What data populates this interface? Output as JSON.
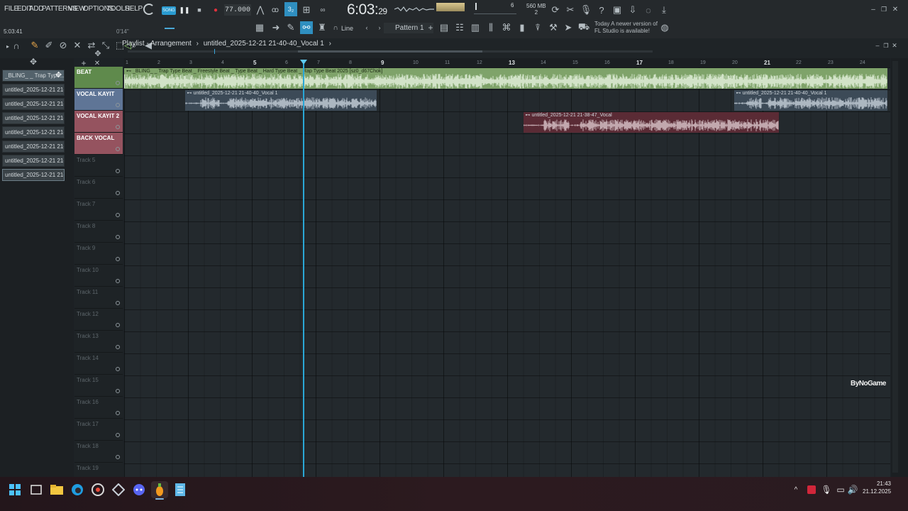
{
  "menu": {
    "items": [
      "FILE",
      "EDIT",
      "ADD",
      "PATTERNS",
      "VIEW",
      "OPTIONS",
      "TOOLS",
      "HELP"
    ]
  },
  "transport": {
    "mode": "SONG",
    "tempo": "77.000",
    "time_main": "6:03",
    "time_sub": "29",
    "pattern": "Pattern 1",
    "snap": "Line",
    "memory": "560 MB",
    "memory_sub": "2",
    "cpu_count": "6",
    "song_position": "5:03:41",
    "hint_time": "0'14\""
  },
  "news": {
    "line1": "Today",
    "line2": "A newer version of",
    "line3": "FL Studio is available!"
  },
  "playlist": {
    "title": "Playlist - Arrangement",
    "crumb": "untitled_2025-12-21 21-40-40_Vocal 1",
    "crumb_arrow": "›"
  },
  "clip_list": [
    "_BLING_ _ Trap Type...",
    "untitled_2025-12-21 21-...",
    "untitled_2025-12-21 21-...",
    "untitled_2025-12-21 21-...",
    "untitled_2025-12-21 21-...",
    "untitled_2025-12-21 21-...",
    "untitled_2025-12-21 21-...",
    "untitled_2025-12-21 21-..."
  ],
  "tracks": [
    {
      "name": "BEAT",
      "color": "#5f8a4c"
    },
    {
      "name": "VOCAL KAYIT",
      "color": "#5f7596"
    },
    {
      "name": "VOCAL KAYIT 2",
      "color": "#95535f"
    },
    {
      "name": "BACK VOCAL",
      "color": "#95535f"
    },
    {
      "name": "Track 5",
      "color": ""
    },
    {
      "name": "Track 6",
      "color": ""
    },
    {
      "name": "Track 7",
      "color": ""
    },
    {
      "name": "Track 8",
      "color": ""
    },
    {
      "name": "Track 9",
      "color": ""
    },
    {
      "name": "Track 10",
      "color": ""
    },
    {
      "name": "Track 11",
      "color": ""
    },
    {
      "name": "Track 12",
      "color": ""
    },
    {
      "name": "Track 13",
      "color": ""
    },
    {
      "name": "Track 14",
      "color": ""
    },
    {
      "name": "Track 15",
      "color": ""
    },
    {
      "name": "Track 16",
      "color": ""
    },
    {
      "name": "Track 17",
      "color": ""
    },
    {
      "name": "Track 18",
      "color": ""
    },
    {
      "name": "Track 19",
      "color": ""
    }
  ],
  "clips": [
    {
      "track": 0,
      "label": "_BLING_ _ Trap Type Beat _ Freestyle Beat _ Type Beat _ Hard Type Beat _ Rap Type Beat 2025 [sz0_d67Chok]",
      "start_bar": 1,
      "end_bar": 24.9,
      "color": "#7fa36a",
      "wave": "#e8f3e0"
    },
    {
      "track": 1,
      "label": "untitled_2025-12-21 21-40-40_Vocal 1",
      "start_bar": 2.9,
      "end_bar": 8.9,
      "color": "#3c4a57",
      "wave": "#c9d3dc"
    },
    {
      "track": 1,
      "label": "untitled_2025-12-21 21-40-40_Vocal 1",
      "start_bar": 20.1,
      "end_bar": 24.9,
      "color": "#3c4a57",
      "wave": "#c9d3dc"
    },
    {
      "track": 2,
      "label": "untitled_2025-12-21 21-38-47_Vocal",
      "start_bar": 13.5,
      "end_bar": 21.5,
      "color": "#5a2b35",
      "wave": "#dcc9cd"
    }
  ],
  "ruler": {
    "bars": [
      "1",
      "2",
      "3",
      "4",
      "5",
      "6",
      "7",
      "8",
      "9",
      "10",
      "11",
      "12",
      "13",
      "14",
      "15",
      "16",
      "17",
      "18",
      "19",
      "20",
      "21",
      "22",
      "23",
      "24"
    ],
    "bold_bars": [
      "5",
      "9",
      "13",
      "17",
      "21"
    ]
  },
  "playhead_bar": 6.6,
  "watermark": "ByNoGame",
  "taskbar": {
    "time": "21:43",
    "date": "21.12.2025"
  }
}
